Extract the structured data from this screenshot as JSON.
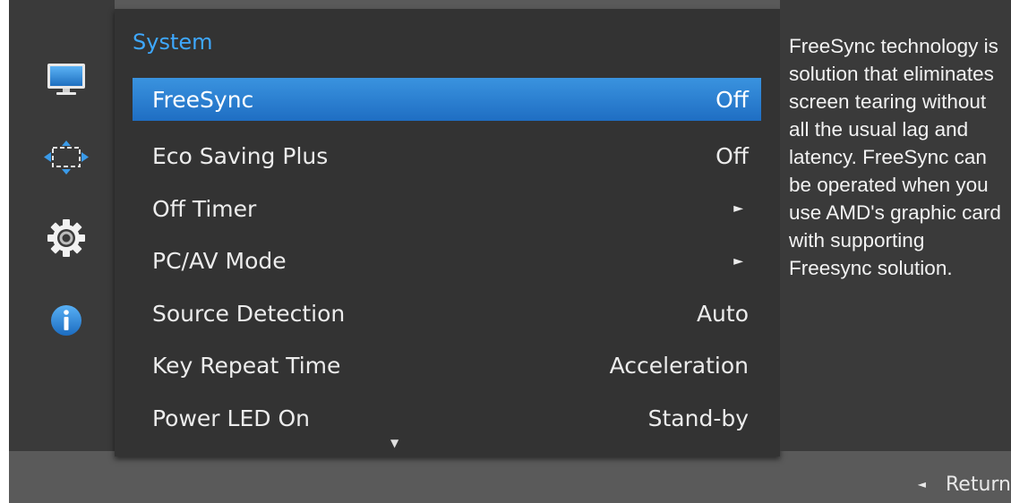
{
  "menu": {
    "title": "System",
    "items": [
      {
        "label": "FreeSync",
        "value": "Off",
        "selected": true
      },
      {
        "label": "Eco Saving Plus",
        "value": "Off"
      },
      {
        "label": "Off Timer",
        "value": "",
        "submenu": true
      },
      {
        "label": "PC/AV Mode",
        "value": "",
        "submenu": true
      },
      {
        "label": "Source Detection",
        "value": "Auto"
      },
      {
        "label": "Key Repeat Time",
        "value": "Acceleration"
      },
      {
        "label": "Power LED On",
        "value": "Stand-by"
      }
    ],
    "more_indicator": "▼"
  },
  "sidebar": {
    "icons": [
      "monitor-icon",
      "screen-adjust-icon",
      "gear-icon",
      "info-icon"
    ]
  },
  "description": {
    "text": "FreeSync technology is solution that eliminates screen tearing without all the usual lag and latency. FreeSync can be operated when you use AMD's graphic card with supporting Freesync solution."
  },
  "footer": {
    "return_arrow": "◄",
    "return_label": "Return"
  },
  "colors": {
    "title": "#3ea8ff",
    "selection": "#2a80d0",
    "panel": "#333333",
    "frame": "#5a5a5a"
  }
}
